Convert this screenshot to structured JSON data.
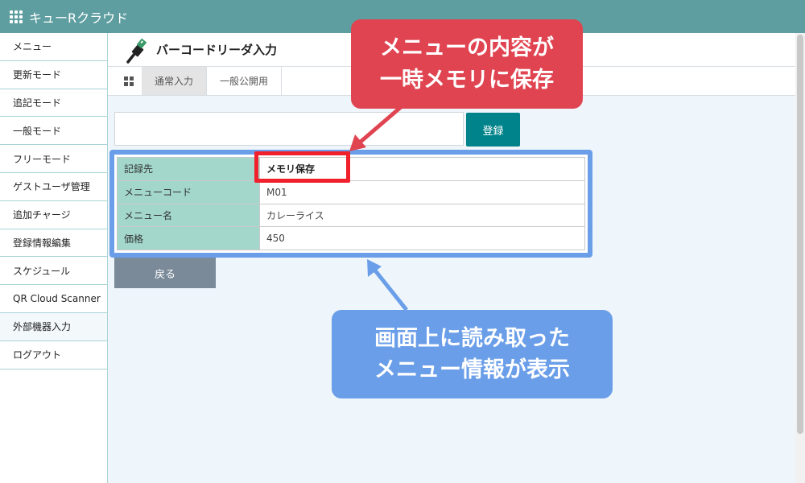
{
  "app": {
    "title": "キューRクラウド"
  },
  "sidebar": {
    "items": [
      {
        "label": "メニュー"
      },
      {
        "label": "更新モード"
      },
      {
        "label": "追記モード"
      },
      {
        "label": "一般モード"
      },
      {
        "label": "フリーモード"
      },
      {
        "label": "ゲストユーザ管理"
      },
      {
        "label": "追加チャージ"
      },
      {
        "label": "登録情報編集"
      },
      {
        "label": "スケジュール"
      },
      {
        "label": "QR Cloud Scanner"
      },
      {
        "label": "外部機器入力"
      },
      {
        "label": "ログアウト"
      }
    ]
  },
  "page": {
    "title": "バーコードリーダ入力",
    "tabs": [
      {
        "label": "通常入力"
      },
      {
        "label": "一般公開用"
      }
    ],
    "register_label": "登録",
    "back_label": "戻る",
    "table": [
      {
        "label": "記録先",
        "value": "メモリ保存"
      },
      {
        "label": "メニューコード",
        "value": "M01"
      },
      {
        "label": "メニュー名",
        "value": "カレーライス"
      },
      {
        "label": "価格",
        "value": "450"
      }
    ]
  },
  "annotations": {
    "red_line1": "メニューの内容が",
    "red_line2": "一時メモリに保存",
    "blue_line1": "画面上に読み取った",
    "blue_line2": "メニュー情報が表示"
  },
  "colors": {
    "header": "#5f9ea0",
    "accent_button": "#00838a",
    "label_cell": "#a3d7cc",
    "callout_red": "#e04451",
    "callout_blue": "#6a9ee8"
  }
}
